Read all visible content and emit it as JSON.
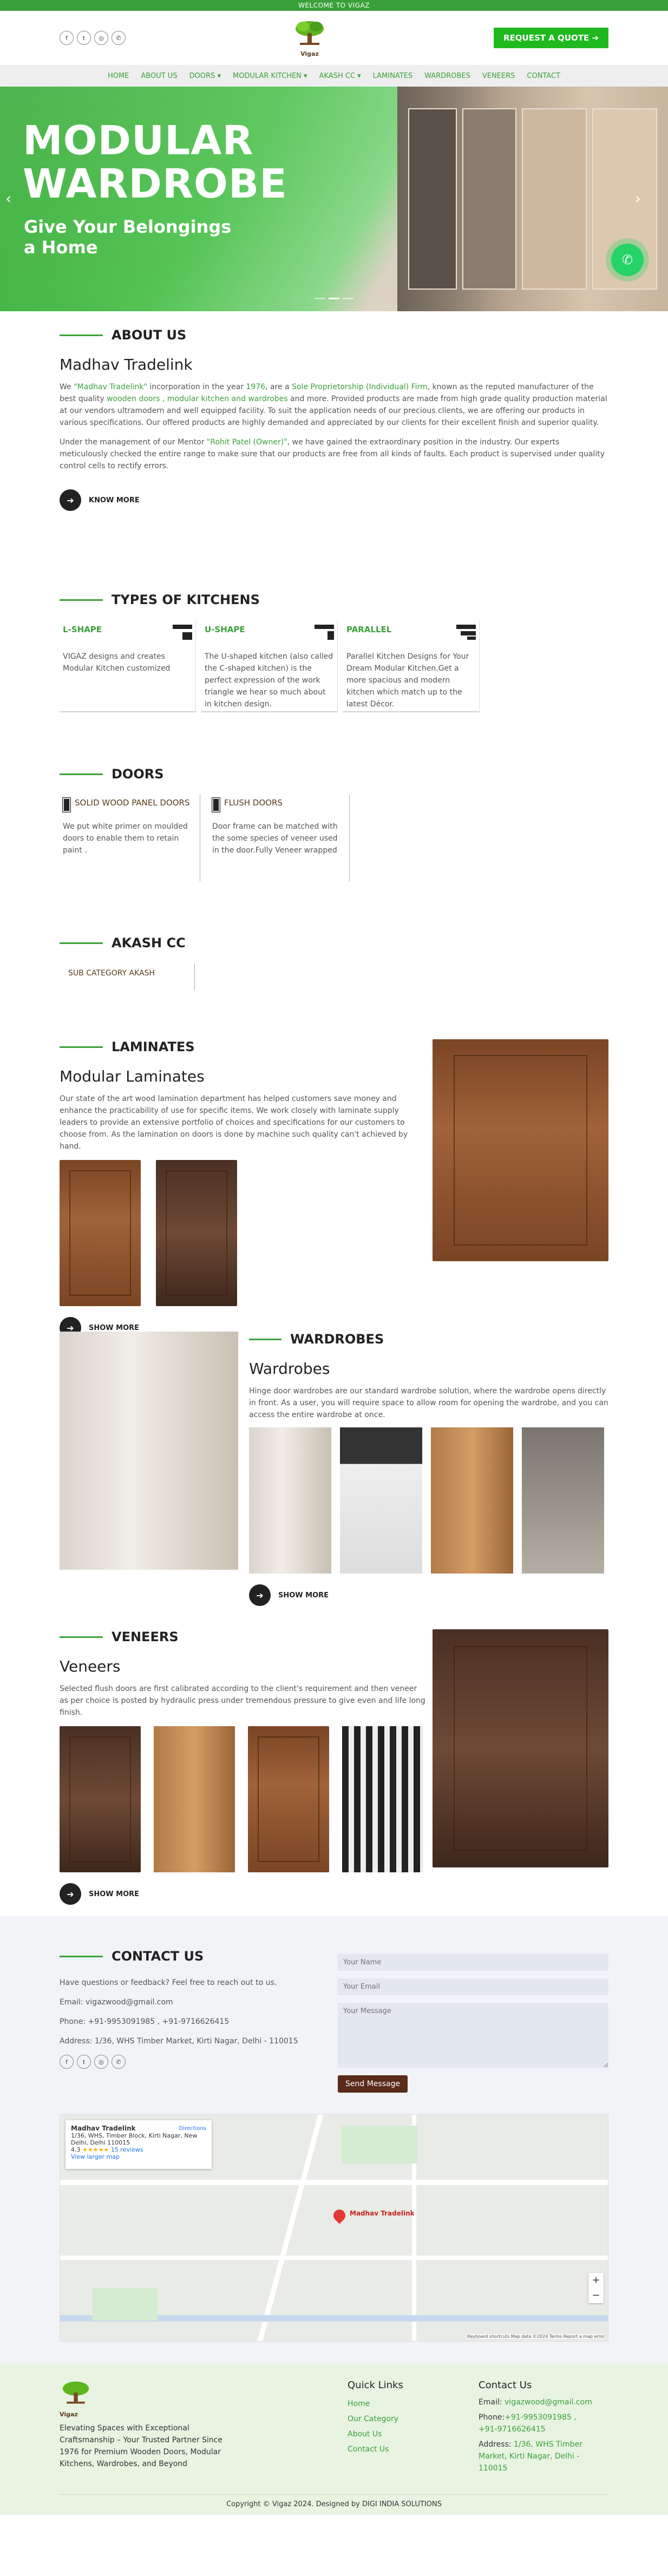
{
  "topbar": {
    "text": "WELCOME TO VIGAZ"
  },
  "header": {
    "socials": [
      "f",
      "t",
      "◎",
      "✆"
    ],
    "logo_text": "Vigaz",
    "quote_button": "REQUEST A QUOTE ➔"
  },
  "nav": [
    "HOME",
    "ABOUT US",
    "DOORS ▾",
    "MODULAR KITCHEN ▾",
    "AKASH CC ▾",
    "LAMINATES",
    "WARDROBES",
    "VENEERS",
    "CONTACT"
  ],
  "hero": {
    "title_line1": "MODULAR",
    "title_line2": "WARDROBE",
    "subtitle_line1": "Give Your Belongings",
    "subtitle_line2": "a Home"
  },
  "about": {
    "heading": "ABOUT US",
    "title": "Madhav Tradelink",
    "p1_a": "We ",
    "p1_link1": "\"Madhav Tradelink\"",
    "p1_b": " incorporation in the year ",
    "p1_year": "1976",
    "p1_c": ", are a ",
    "p1_link2": "Sole Proprietorship (Individual) Firm",
    "p1_d": ", known as the reputed manufacturer of the best quality ",
    "p1_link3": "wooden doors , modular kitchen and wardrobes",
    "p1_e": " and more. Provided products are made from high grade quality production material at our vendors ultramodern and well equipped facility. To suit the application needs of our precious clients, we are offering our products in various specifications. Our offered products are highly demanded and appreciated by our clients for their excellent finish and superior quality.",
    "p2_a": "Under the management of our Mentor ",
    "p2_link": "\"Rohit Patel (Owner)\"",
    "p2_b": ", we have gained the extraordinary position in the industry. Our experts meticulously checked the entire range to make sure that our products are free from all kinds of faults. Each product is supervised under quality control cells to rectify errors.",
    "more": "KNOW MORE"
  },
  "kitchens": {
    "heading": "TYPES OF KITCHENS",
    "cards": [
      {
        "title": "L-SHAPE",
        "text": "VIGAZ designs and creates Modular Kitchen customized"
      },
      {
        "title": "U-SHAPE",
        "text": "The U-shaped kitchen (also called the C-shaped kitchen) is the perfect expression of the work triangle we hear so much about in kitchen design."
      },
      {
        "title": "PARALLEL",
        "text": "Parallel Kitchen Designs for Your Dream Modular Kitchen.Get a more spacious and modern kitchen which match up to the latest Décor."
      }
    ]
  },
  "doors": {
    "heading": "DOORS",
    "cards": [
      {
        "title": "SOLID WOOD PANEL DOORS",
        "text": "We put white primer on moulded doors to enable them to retain paint ."
      },
      {
        "title": "FLUSH DOORS",
        "text": "Door frame can be matched with the some species of veneer used in the door.Fully Veneer wrapped"
      }
    ]
  },
  "akash": {
    "heading": "AKASH CC",
    "sub": "SUB CATEGORY AKASH"
  },
  "laminates": {
    "heading": "LAMINATES",
    "title": "Modular Laminates",
    "text": "Our state of the art wood lamination department has helped customers save money and enhance the practicability of use for specific items. We work closely with laminate supply leaders to provide an extensive portfolio of choices and specifications for our customers to choose from. As the lamination on doors is done by machine such quality can't achieved by hand.",
    "more": "SHOW MORE"
  },
  "wardrobes": {
    "heading": "WARDROBES",
    "title": "Wardrobes",
    "text": "Hinge door wardrobes are our standard wardrobe solution, where the wardrobe opens directly in front. As a user, you will require space to allow room for opening the wardrobe, and you can access the entire wardrobe at once.",
    "more": "SHOW MORE"
  },
  "veneers": {
    "heading": "VENEERS",
    "title": "Veneers",
    "text": "Selected flush doors are first calibrated according to the client's requirement and then veneer as per choice is posted by hydraulic press under tremendous pressure to give even and life long finish.",
    "more": "SHOW MORE"
  },
  "contact": {
    "heading": "CONTACT US",
    "intro": "Have questions or feedback? Feel free to reach out to us.",
    "email": "Email: vigazwood@gmail.com",
    "phone": "Phone: +91-9953091985 , +91-9716626415",
    "address": "Address: 1/36, WHS Timber Market, Kirti Nagar, Delhi - 110015",
    "name_ph": "Your Name",
    "email_ph": "Your Email",
    "msg_ph": "Your Message",
    "send": "Send Message"
  },
  "map": {
    "place": "Madhav Tradelink",
    "addr": "1/36, WHS, Timber Block, Kirti Nagar, New Delhi, Delhi 110015",
    "rating": "4.3",
    "reviews": "15 reviews",
    "larger": "View larger map",
    "directions": "Directions",
    "pin_label": "Madhav Tradelink",
    "footer": "Keyboard shortcuts   Map data ©2024   Terms   Report a map error"
  },
  "footer": {
    "logo_text": "Vigaz",
    "tagline": "Elevating Spaces with Exceptional Craftsmanship – Your Trusted Partner Since 1976 for Premium Wooden Doors, Modular Kitchens, Wardrobes, and Beyond",
    "quick_title": "Quick Links",
    "links": [
      "Home",
      "Our Category",
      "About Us",
      "Contact Us"
    ],
    "contact_title": "Contact Us",
    "email_label": "Email: ",
    "email": "vigazwood@gmail.com",
    "phone_label": "Phone:",
    "phone1": "+91-9953091985 ,",
    "phone2": "+91-9716626415",
    "address_label": "Address: ",
    "address": "1/36, WHS Timber Market, Kirti Nagar, Delhi - 110015",
    "copyright": "Copyright © Vigaz 2024. Designed by DIGI INDIA SOLUTIONS"
  },
  "colors": {
    "brand_green": "#3aa13a",
    "accent_brown": "#5a2a1a",
    "button_green": "#1fb81f"
  }
}
